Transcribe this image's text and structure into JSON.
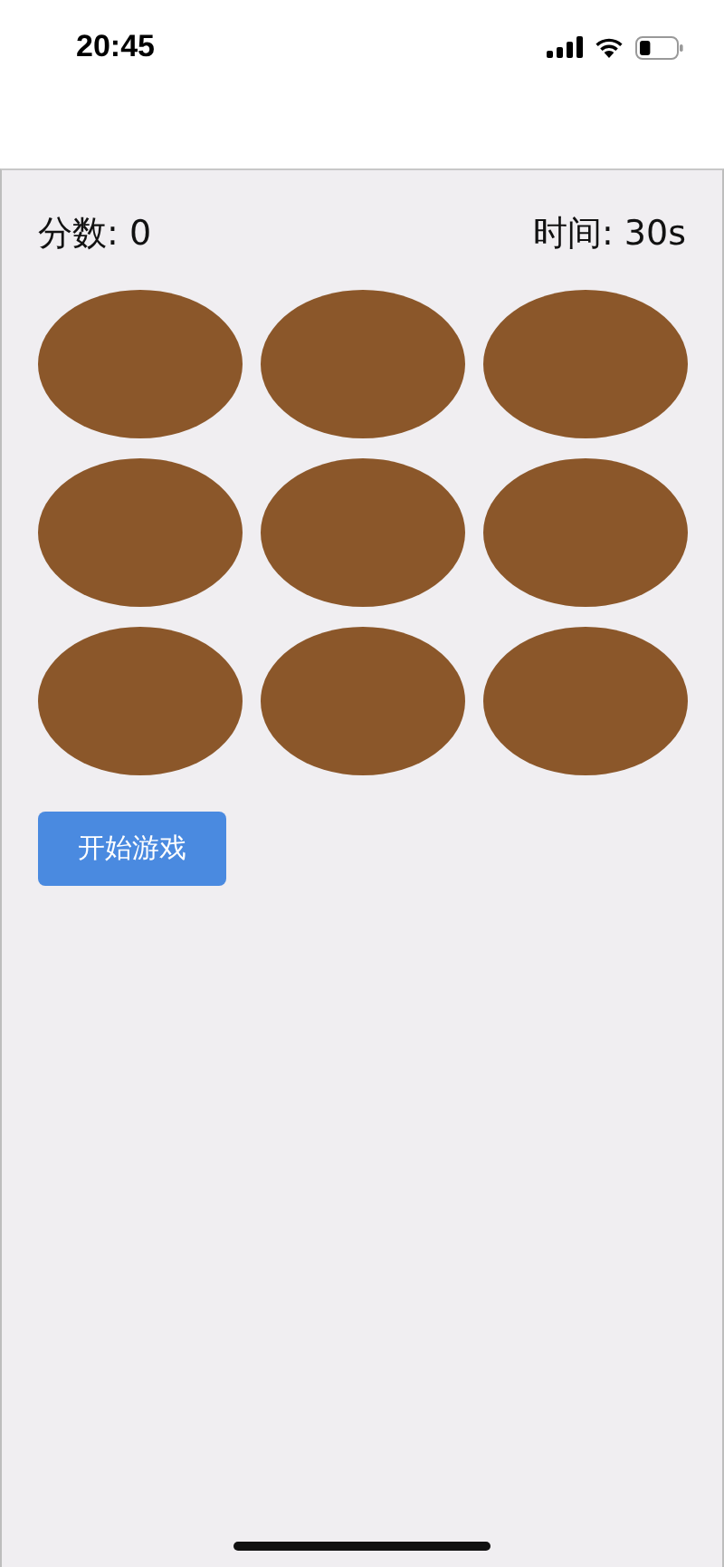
{
  "status_bar": {
    "time": "20:45"
  },
  "score": "分数: 0",
  "timer": "时间: 30s",
  "holes": [
    {
      "mole": false
    },
    {
      "mole": false
    },
    {
      "mole": false
    },
    {
      "mole": false
    },
    {
      "mole": false
    },
    {
      "mole": false
    },
    {
      "mole": false
    },
    {
      "mole": false
    },
    {
      "mole": false
    }
  ],
  "start_button": "开始游戏"
}
